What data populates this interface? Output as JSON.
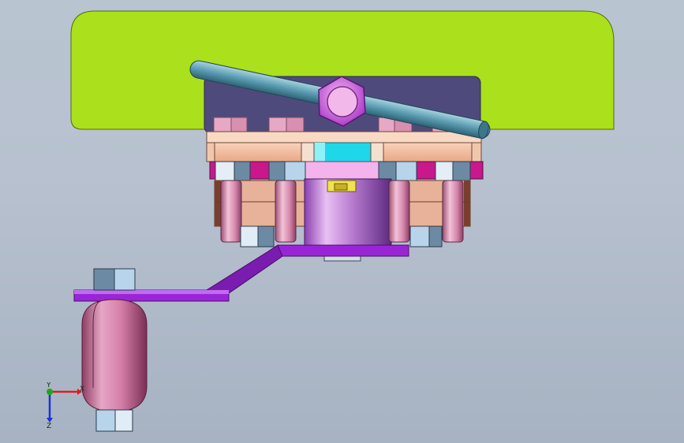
{
  "viewport": {
    "background_top": "#b9c4d1",
    "background_bottom": "#a7b2c2"
  },
  "model": {
    "plate_color": "#abe01c",
    "bracket_color": "#9b25d6",
    "rod_color": "#5fa0b4",
    "nut_color": "#c04fd0",
    "bolt_color": "#e1a3c8",
    "tank_color": "#d07aa4",
    "flange_color": "#f6c4a4",
    "ring_color": "#f7b3ea",
    "hub_color": "#1ed7e8"
  },
  "triad": {
    "x_label": "X",
    "y_label": "Y",
    "z_label": "Z",
    "x_color": "#e01c1c",
    "y_color": "#1ca81c",
    "z_color": "#1c2ee0"
  }
}
